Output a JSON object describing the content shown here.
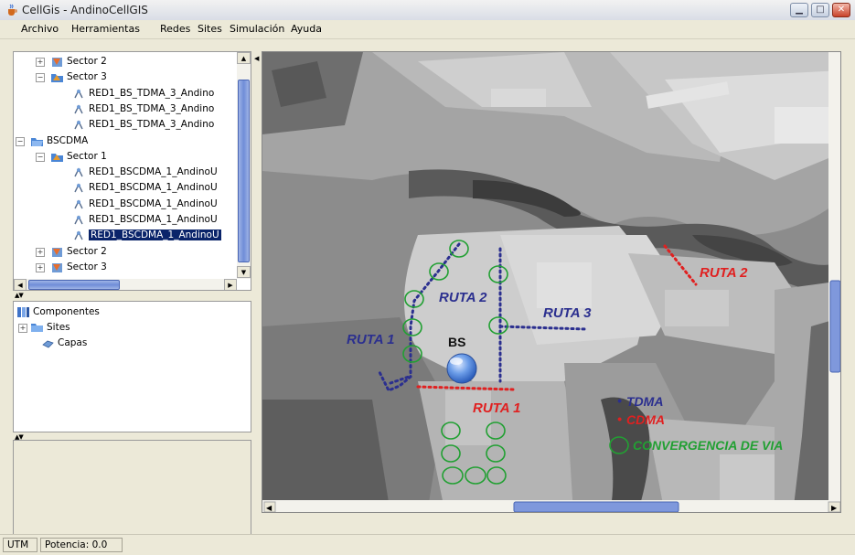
{
  "window": {
    "title": "CellGis - AndinoCellGIS"
  },
  "menu": [
    "Archivo",
    "Herramientas",
    "Redes",
    "Sites",
    "Simulación",
    "Ayuda"
  ],
  "tree": {
    "rows": [
      {
        "label": "Sector 2",
        "level": 2,
        "expander": "+",
        "icon": "sector-icon"
      },
      {
        "label": "Sector 3",
        "level": 2,
        "expander": "-",
        "icon": "sector-open-icon"
      },
      {
        "label": "RED1_BS_TDMA_3_Andino",
        "level": 3,
        "icon": "antenna-icon"
      },
      {
        "label": "RED1_BS_TDMA_3_Andino",
        "level": 3,
        "icon": "antenna-icon"
      },
      {
        "label": "RED1_BS_TDMA_3_Andino",
        "level": 3,
        "icon": "antenna-icon"
      },
      {
        "label": "BSCDMA",
        "level": 1,
        "expander": "-",
        "icon": "folder-open-icon"
      },
      {
        "label": "Sector 1",
        "level": 2,
        "expander": "-",
        "icon": "sector-open-icon"
      },
      {
        "label": "RED1_BSCDMA_1_AndinoU",
        "level": 3,
        "icon": "antenna-icon"
      },
      {
        "label": "RED1_BSCDMA_1_AndinoU",
        "level": 3,
        "icon": "antenna-icon"
      },
      {
        "label": "RED1_BSCDMA_1_AndinoU",
        "level": 3,
        "icon": "antenna-icon"
      },
      {
        "label": "RED1_BSCDMA_1_AndinoU",
        "level": 3,
        "icon": "antenna-icon"
      },
      {
        "label": "RED1_BSCDMA_1_AndinoU",
        "level": 3,
        "icon": "antenna-icon",
        "selected": true
      },
      {
        "label": "Sector 2",
        "level": 2,
        "expander": "+",
        "icon": "sector-icon"
      },
      {
        "label": "Sector 3",
        "level": 2,
        "expander": "+",
        "icon": "sector-icon"
      }
    ]
  },
  "components": {
    "root": "Componentes",
    "children": [
      {
        "label": "Sites",
        "expander": "+",
        "icon": "folder-icon"
      },
      {
        "label": "Capas",
        "icon": "layers-icon"
      }
    ]
  },
  "map": {
    "labels": {
      "bs": "BS",
      "ruta1_blue": "RUTA 1",
      "ruta2_blue": "RUTA 2",
      "ruta3_blue": "RUTA 3",
      "ruta1_red": "RUTA 1",
      "ruta2_red": "RUTA 2",
      "legend_tdma": "TDMA",
      "legend_cdma": "CDMA",
      "legend_convergencia": "CONVERGENCIA DE VIA"
    },
    "colors": {
      "tdma": "#2b2f8f",
      "cdma": "#e02020",
      "convergencia": "#22a033"
    }
  },
  "statusbar": {
    "coord": "UTM",
    "potencia_label": "Potencia:",
    "potencia_value": "0.0"
  }
}
